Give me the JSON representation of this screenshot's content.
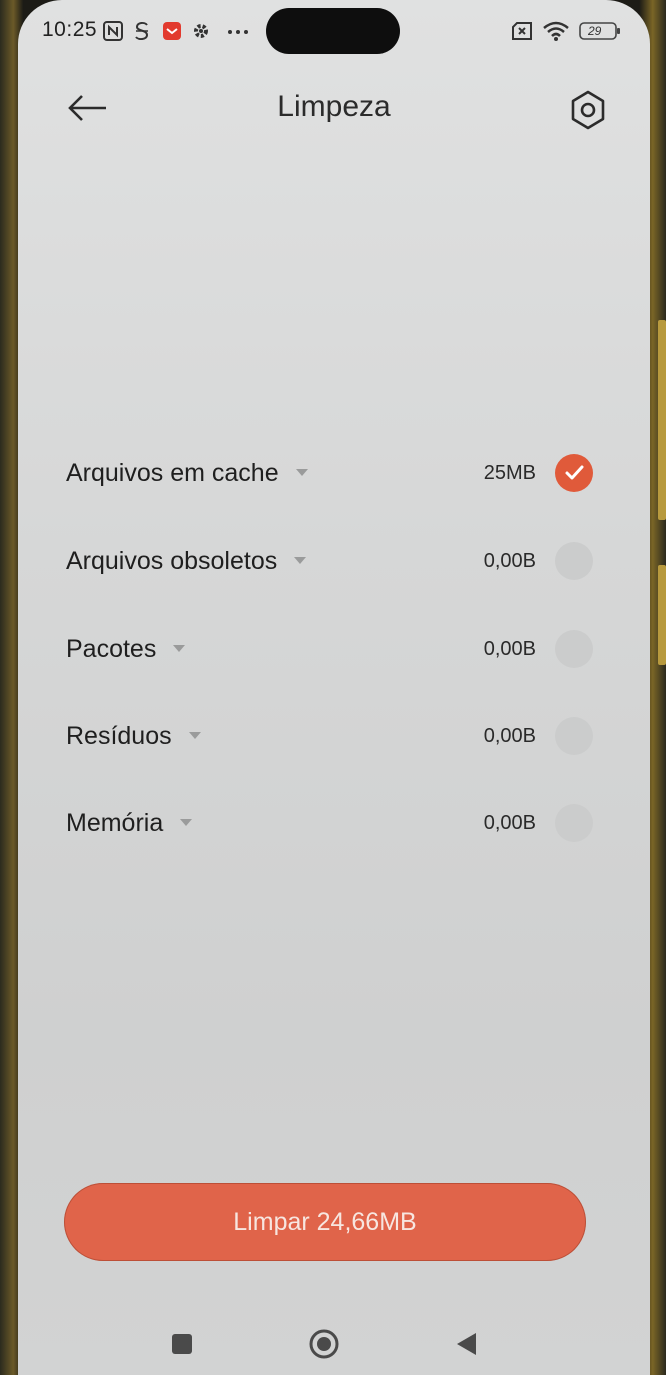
{
  "status_bar": {
    "time": "10:25",
    "left_icons": [
      "nfc-icon",
      "s-app-icon",
      "mail-app-icon",
      "settings-gear-icon",
      "more-dots-icon"
    ],
    "right_icons": [
      "sim-off-icon",
      "wifi-icon",
      "battery-icon"
    ],
    "battery_level": "29"
  },
  "header": {
    "title": "Limpeza",
    "back_icon": "arrow-left-icon",
    "settings_icon": "hexagon-settings-icon"
  },
  "items": [
    {
      "label": "Arquivos em cache",
      "size": "25MB",
      "checked": true
    },
    {
      "label": "Arquivos obsoletos",
      "size": "0,00B",
      "checked": false
    },
    {
      "label": "Pacotes",
      "size": "0,00B",
      "checked": false
    },
    {
      "label": "Resíduos",
      "size": "0,00B",
      "checked": false
    },
    {
      "label": "Memória",
      "size": "0,00B",
      "checked": false
    }
  ],
  "action_button": {
    "label": "Limpar 24,66MB",
    "color": "#e0644a"
  },
  "nav_bar": {
    "buttons": [
      "recent-apps-icon",
      "home-icon",
      "back-triangle-icon"
    ]
  },
  "colors": {
    "accent": "#e05a3a",
    "background": "#d6d7d7"
  }
}
